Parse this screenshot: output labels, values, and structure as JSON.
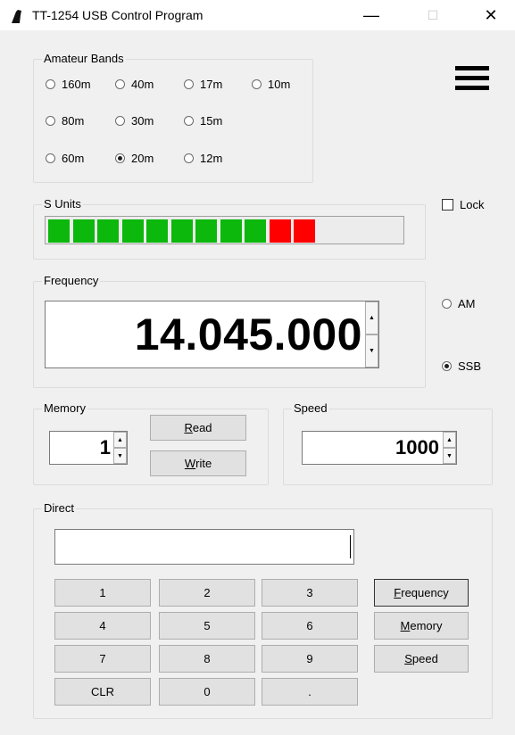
{
  "window": {
    "title": "TT-1254 USB Control Program",
    "minimize_glyph": "—",
    "maximize_glyph": "☐",
    "close_glyph": "✕"
  },
  "menu_icon": "hamburger-menu-icon",
  "amateur_bands": {
    "legend": "Amateur Bands",
    "options": [
      {
        "label": "160m",
        "selected": false
      },
      {
        "label": "40m",
        "selected": false
      },
      {
        "label": "17m",
        "selected": false
      },
      {
        "label": "10m",
        "selected": false
      },
      {
        "label": "80m",
        "selected": false
      },
      {
        "label": "30m",
        "selected": false
      },
      {
        "label": "15m",
        "selected": false
      },
      {
        "label": "60m",
        "selected": false
      },
      {
        "label": "20m",
        "selected": true
      },
      {
        "label": "12m",
        "selected": false
      }
    ]
  },
  "s_units": {
    "legend": "S Units",
    "level_segments": 11,
    "total_segments": 14,
    "green_segments": 9,
    "colors": {
      "green": "#0cb80c",
      "red": "#ff0000"
    }
  },
  "lock": {
    "label": "Lock",
    "checked": false
  },
  "frequency": {
    "legend": "Frequency",
    "value": "14.045.000"
  },
  "mode": {
    "am": {
      "label": "AM",
      "selected": false
    },
    "ssb": {
      "label": "SSB",
      "selected": true
    }
  },
  "memory": {
    "legend": "Memory",
    "value": "1",
    "read_button": {
      "mnemonic": "R",
      "rest": "ead"
    },
    "write_button": {
      "mnemonic": "W",
      "rest": "rite"
    }
  },
  "speed": {
    "legend": "Speed",
    "value": "1000"
  },
  "direct": {
    "legend": "Direct",
    "input_value": "",
    "keypad": [
      "1",
      "2",
      "3",
      "4",
      "5",
      "6",
      "7",
      "8",
      "9",
      "CLR",
      "0",
      "."
    ],
    "frequency_button": {
      "mnemonic": "F",
      "rest": "requency"
    },
    "memory_button": {
      "mnemonic": "M",
      "rest": "emory"
    },
    "speed_button": {
      "mnemonic": "S",
      "rest": "peed"
    }
  }
}
